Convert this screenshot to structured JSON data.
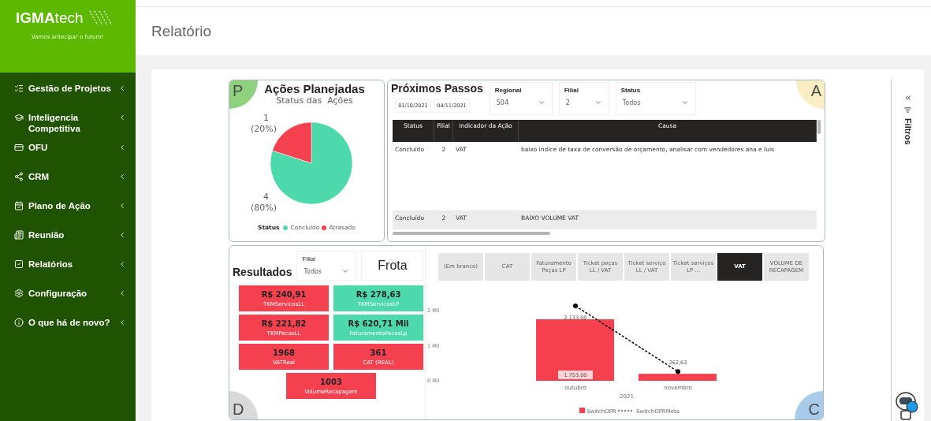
{
  "sidebar": {
    "logo": {
      "brand_bold": "IGMA",
      "brand_light": "tech",
      "tagline": "Vamos antecipar o futuro!"
    },
    "items": [
      {
        "label": "Gestão de Projetos"
      },
      {
        "label": "Inteligencia Competitiva"
      },
      {
        "label": "OFU"
      },
      {
        "label": "CRM"
      },
      {
        "label": "Plano de Ação"
      },
      {
        "label": "Reunião"
      },
      {
        "label": "Relatórios"
      },
      {
        "label": "Configuração"
      },
      {
        "label": "O que há de novo?"
      }
    ]
  },
  "header": {
    "title": "Relatório"
  },
  "planned_actions": {
    "badge": {
      "letter": "P",
      "color": "#8fd17f"
    },
    "title": "Ações Planejadas",
    "chart_data": {
      "type": "pie",
      "title": "Status das  Ações",
      "categories": [
        "Concluído",
        "Atrasado"
      ],
      "series": [
        {
          "name": "Status",
          "values": [
            4,
            1
          ],
          "value_labels": [
            "4",
            "1"
          ]
        }
      ],
      "data_labels": true
    },
    "share_labels": [
      "(20%)",
      "(80%)"
    ],
    "slice_colors": [
      {
        "color": "#4dd9ac"
      },
      {
        "color": "#f5414f"
      }
    ]
  },
  "next_steps": {
    "title": "Próximos Passos",
    "badge": {
      "letter": "A",
      "color": "#fbeec4"
    },
    "date_range": [
      "01/10/2021",
      "04/11/2021"
    ],
    "dropdowns": [
      {
        "label": "Regional",
        "value": "504"
      },
      {
        "label": "Filial",
        "value": "2"
      },
      {
        "label": "Status",
        "value": "Todos"
      }
    ],
    "table": {
      "columns": [
        "Status",
        "Filial",
        "Indicador da Ação",
        "Causa"
      ],
      "rows": [
        [
          "Concluído",
          "2",
          "VAT",
          "baixo indice de taxa de conversão de orçamento, analisar com vendedores ana e luis"
        ],
        [
          "Concluído",
          "2",
          "VAT",
          "BAIXO VOLUME VAT"
        ]
      ]
    }
  },
  "results": {
    "title": "Resultados",
    "badge": {
      "letter": "D",
      "color": "#d9d9d9"
    },
    "corner_badge": {
      "letter": "C",
      "color": "#a9cbea"
    },
    "filter": {
      "label": "Filial",
      "value": "Todos"
    },
    "segment": "Frota",
    "kpis": [
      {
        "value": "R$ 240,91",
        "label": "TKMServicosLL",
        "color": "#f5414f"
      },
      {
        "value": "R$ 278,63",
        "label": "TKMServicosLP",
        "color": "#4dd9ac"
      },
      {
        "value": "R$ 221,82",
        "label": "TKMPecasLL",
        "color": "#f5414f"
      },
      {
        "value": "R$ 620,71 Mil",
        "label": "FaturamentoPecasLp",
        "color": "#4dd9ac"
      },
      {
        "value": "1968",
        "label": "VATReal",
        "color": "#f5414f"
      },
      {
        "value": "361",
        "label": "CAT (REAL)",
        "color": "#f5414f"
      },
      {
        "value": "1003",
        "label": "VolumeRecapagem",
        "color": "#f5414f"
      }
    ],
    "tabs": [
      {
        "label": "(Em branco)",
        "selected": false
      },
      {
        "label": "CAT",
        "selected": false
      },
      {
        "label": "Faturamento Peças LP",
        "selected": false
      },
      {
        "label": "Ticket peças LL / VAT",
        "selected": false
      },
      {
        "label": "Ticket serviço LL / VAT",
        "selected": false
      },
      {
        "label": "Ticket serviços LP ...",
        "selected": false
      },
      {
        "label": "VAT",
        "selected": true
      },
      {
        "label": "VOLUME DE RECAPAGEM",
        "selected": false
      }
    ],
    "y_axis_labels": [
      "2 Mil",
      "1 Mil",
      "0 Mil"
    ],
    "chart_data": {
      "type": "bar",
      "xlabel": "2021",
      "legend": "bottom",
      "categories": [
        "outubro",
        "novembro"
      ],
      "series": [
        {
          "name": "SwitchOPR",
          "color": "#f5414f",
          "values": [
            1753,
            200
          ],
          "value_labels": [
            "1.753,00",
            null
          ]
        },
        {
          "name": "SwitchOPRMeta",
          "type": "line",
          "line_style": "dashed",
          "marker": "circle",
          "color": "#000000",
          "values": [
            2133,
            262.63
          ],
          "value_labels": [
            "2.133,00",
            "262,63"
          ]
        }
      ]
    }
  },
  "filters_pane": {
    "title": "Filtros"
  }
}
